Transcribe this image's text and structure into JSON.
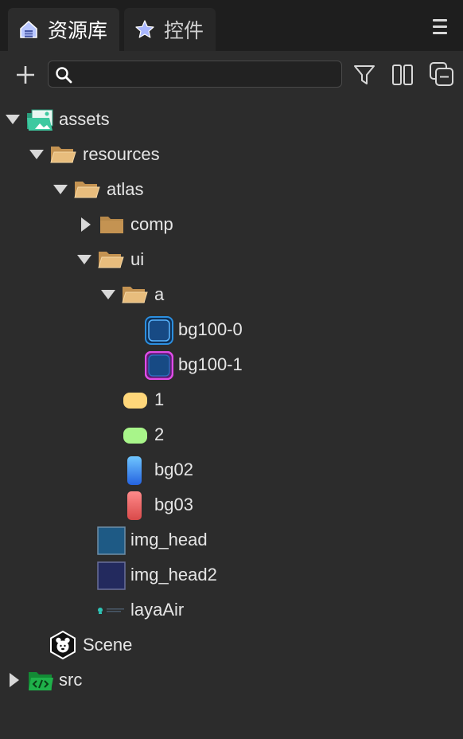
{
  "tabs": [
    {
      "label": "资源库",
      "icon": "home-icon",
      "active": true
    },
    {
      "label": "控件",
      "icon": "star-icon",
      "active": false
    }
  ],
  "toolbar": {
    "add_icon": "plus-icon",
    "search_value": "",
    "search_placeholder": "",
    "filter_icon": "filter-icon",
    "layout_icon": "two-column-icon",
    "collapse_icon": "collapse-all-icon"
  },
  "tree": [
    {
      "label": "assets",
      "icon": "assets-folder-icon",
      "expanded": true
    },
    {
      "label": "resources",
      "icon": "folder-open-icon",
      "expanded": true
    },
    {
      "label": "atlas",
      "icon": "folder-open-icon",
      "expanded": true
    },
    {
      "label": "comp",
      "icon": "folder-closed-icon",
      "expanded": false
    },
    {
      "label": "ui",
      "icon": "folder-open-icon",
      "expanded": true
    },
    {
      "label": "a",
      "icon": "folder-open-icon",
      "expanded": true
    },
    {
      "label": "bg100-0",
      "icon": "image-thumbnail-icon"
    },
    {
      "label": "bg100-1",
      "icon": "image-thumbnail-icon"
    },
    {
      "label": "1",
      "icon": "image-thumbnail-icon"
    },
    {
      "label": "2",
      "icon": "image-thumbnail-icon"
    },
    {
      "label": "bg02",
      "icon": "image-thumbnail-icon"
    },
    {
      "label": "bg03",
      "icon": "image-thumbnail-icon"
    },
    {
      "label": "img_head",
      "icon": "image-thumbnail-icon"
    },
    {
      "label": "img_head2",
      "icon": "image-thumbnail-icon"
    },
    {
      "label": "layaAir",
      "icon": "image-thumbnail-icon"
    },
    {
      "label": "Scene",
      "icon": "scene-icon"
    },
    {
      "label": "src",
      "icon": "src-folder-icon",
      "expanded": false
    }
  ],
  "colors": {
    "panel_bg": "#2c2c2c",
    "tabbar_bg": "#1e1e1e",
    "folder": "#e3b574",
    "assets_folder": "#3ec9a0",
    "src_folder": "#1fb14a"
  }
}
